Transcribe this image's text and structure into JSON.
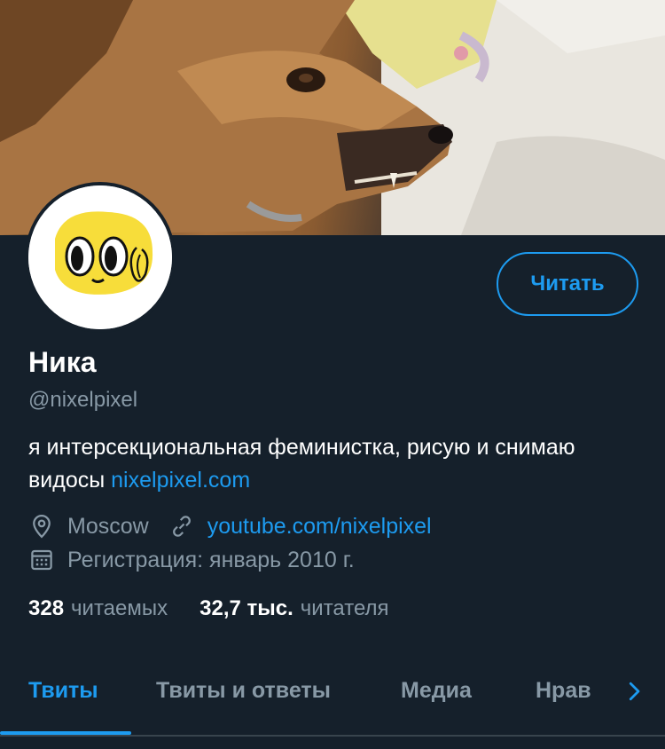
{
  "profile": {
    "name": "Ника",
    "handle": "@nixelpixel",
    "bio_text": "я интерсекциональная феминистка, рисую и снимаю видосы ",
    "bio_link": "nixelpixel.com",
    "location": "Moscow",
    "website": "youtube.com/nixelpixel",
    "joined": "Регистрация: январь 2010 г."
  },
  "actions": {
    "follow_label": "Читать"
  },
  "stats": {
    "following_count": "328",
    "following_label": "читаемых",
    "followers_count": "32,7 тыс.",
    "followers_label": "читателя"
  },
  "tabs": [
    {
      "label": "Твиты",
      "active": true
    },
    {
      "label": "Твиты и ответы",
      "active": false
    },
    {
      "label": "Медиа",
      "active": false
    },
    {
      "label": "Нрав",
      "active": false
    }
  ],
  "icons": {
    "location": "location-pin-icon",
    "link": "link-icon",
    "calendar": "calendar-icon",
    "tab_scroll": "chevron-right-icon"
  },
  "colors": {
    "background": "#15202b",
    "accent": "#1d9bf0",
    "secondary_text": "#8899a6"
  }
}
